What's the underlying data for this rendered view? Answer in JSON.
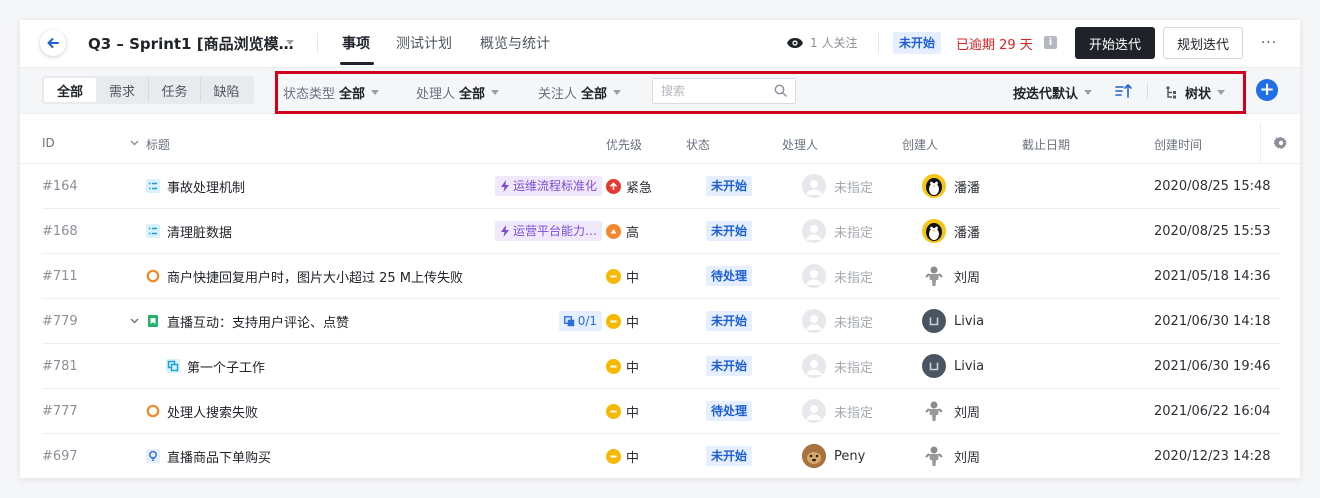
{
  "header": {
    "title": "Q3 – Sprint1 [商品浏览模…",
    "tabs": [
      {
        "label": "事项"
      },
      {
        "label": "测试计划"
      },
      {
        "label": "概览与统计"
      }
    ],
    "followers": "1 人关注",
    "status": "未开始",
    "overdue": "已逾期 29 天",
    "info_glyph": "i",
    "start_button": "开始迭代",
    "plan_button": "规划迭代",
    "more_glyph": "···"
  },
  "toolbar": {
    "segments": [
      "全部",
      "需求",
      "任务",
      "缺陷"
    ],
    "filters": {
      "type": {
        "label": "状态类型",
        "value": "全部"
      },
      "assignee": {
        "label": "处理人",
        "value": "全部"
      },
      "follower": {
        "label": "关注人",
        "value": "全部"
      }
    },
    "search_placeholder": "搜索",
    "sort_label": "按迭代默认",
    "view_label": "树状",
    "add_glyph": "+"
  },
  "table": {
    "columns": {
      "id": "ID",
      "title": "标题",
      "priority": "优先级",
      "status": "状态",
      "assignee": "处理人",
      "creator": "创建人",
      "due": "截止日期",
      "created": "创建时间"
    },
    "rows": [
      {
        "id": "#164",
        "type": "task",
        "title": "事故处理机制",
        "tag": "运维流程标准化",
        "priority": "紧急",
        "status": "未开始",
        "assignee": "未指定",
        "creator": "潘潘",
        "due": "",
        "created": "2020/08/25 15:48"
      },
      {
        "id": "#168",
        "type": "task",
        "title": "清理脏数据",
        "tag": "运营平台能力…",
        "priority": "高",
        "status": "未开始",
        "assignee": "未指定",
        "creator": "潘潘",
        "due": "",
        "created": "2020/08/25 15:53"
      },
      {
        "id": "#711",
        "type": "bug",
        "title": "商户快捷回复用户时，图片大小超过 25 M上传失败",
        "tag": "",
        "priority": "中",
        "status": "待处理",
        "assignee": "未指定",
        "creator": "刘周",
        "due": "",
        "created": "2021/05/18 14:36"
      },
      {
        "id": "#779",
        "type": "story",
        "title": "直播互动：支持用户评论、点赞",
        "tag": "0/1",
        "priority": "中",
        "status": "未开始",
        "assignee": "未指定",
        "creator": "Livia",
        "due": "",
        "created": "2021/06/30 14:18"
      },
      {
        "id": "#781",
        "type": "subtask",
        "title": "第一个子工作",
        "tag": "",
        "priority": "中",
        "status": "未开始",
        "assignee": "未指定",
        "creator": "Livia",
        "due": "",
        "created": "2021/06/30 19:46"
      },
      {
        "id": "#777",
        "type": "bug",
        "title": "处理人搜索失败",
        "tag": "",
        "priority": "中",
        "status": "待处理",
        "assignee": "未指定",
        "creator": "刘周",
        "due": "",
        "created": "2021/06/22 16:04"
      },
      {
        "id": "#697",
        "type": "idea",
        "title": "直播商品下单购买",
        "tag": "",
        "priority": "中",
        "status": "未开始",
        "assignee": "Peny",
        "creator": "刘周",
        "due": "",
        "created": "2020/12/23 14:28"
      }
    ]
  },
  "colors": {
    "primary_dark": "#1f2329",
    "accent_blue": "#1f6fe8",
    "overdue_red": "#e02020",
    "highlight_red": "#d0021b",
    "priority_urgent": "#e5392e",
    "priority_high": "#f5862a",
    "priority_medium": "#f7b900",
    "tag_purple": "#7d4cdb"
  }
}
